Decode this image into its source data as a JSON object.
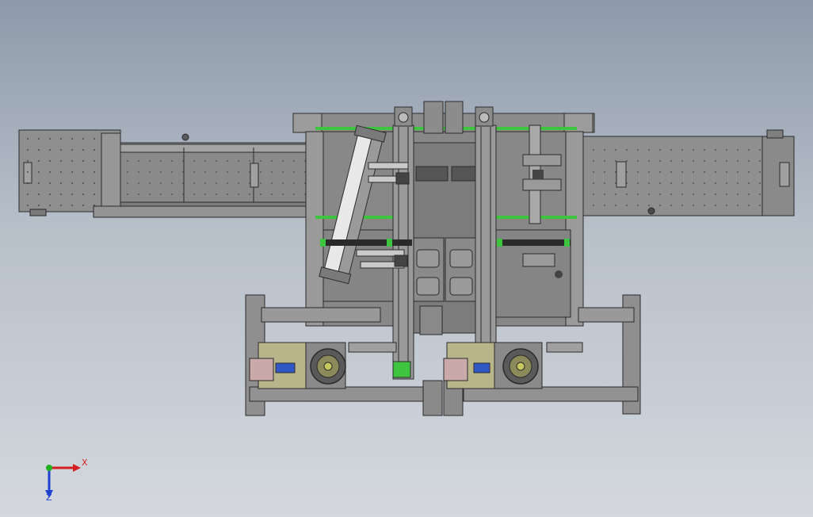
{
  "viewport": {
    "background_top": "#8e9aaa",
    "background_bottom": "#d4d8de"
  },
  "colors": {
    "frame_fill": "#8f8f8f",
    "frame_dark": "#6f6f6f",
    "frame_light": "#a9a9a9",
    "edge": "#2b2b2b",
    "rail_green": "#3ec43e",
    "cylinder_white": "#e8e8e8",
    "motor_plate": "#b8b58a",
    "motor_block": "#c9a9a9",
    "motor_blue": "#2f57c8"
  },
  "triad": {
    "x_label": "X",
    "z_label": "Z",
    "x_color": "#d42020",
    "y_color": "#20b020",
    "z_color": "#2040d0",
    "icons": [
      "axis-triad-icon"
    ]
  }
}
